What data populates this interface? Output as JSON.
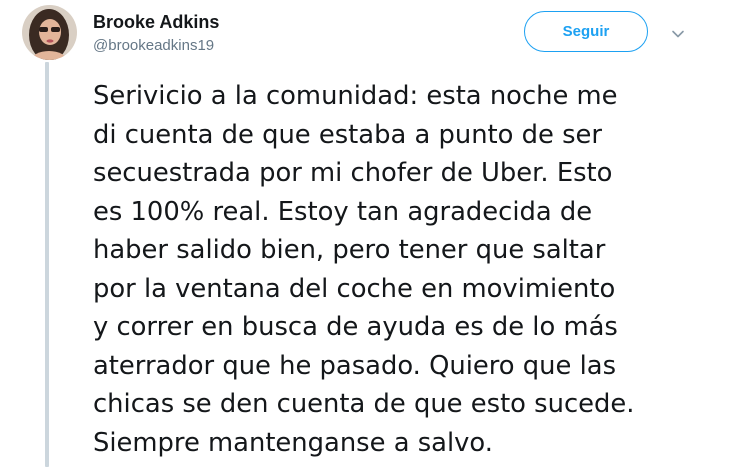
{
  "author": {
    "display_name": "Brooke Adkins",
    "handle": "@brookeadkins19",
    "avatar_icon": "user-avatar-photo"
  },
  "actions": {
    "follow_label": "Seguir",
    "more_icon": "chevron-down-icon"
  },
  "tweet": {
    "text": "Serivicio a la comunidad: esta noche me\ndi cuenta de que estaba a punto de ser\nsecuestrada por mi chofer de Uber. Esto\nes 100% real. Estoy tan agradecida de\nhaber salido bien, pero tener que saltar\npor la ventana del coche en movimiento\ny correr en busca de ayuda es de lo más\naterrador que he pasado. Quiero que las\nchicas se den cuenta de que esto sucede.\nSiempre mantenganse a salvo."
  },
  "colors": {
    "accent": "#1da1f2",
    "text_primary": "#14171a",
    "text_secondary": "#657786",
    "thread_line": "#ccd6dd"
  }
}
